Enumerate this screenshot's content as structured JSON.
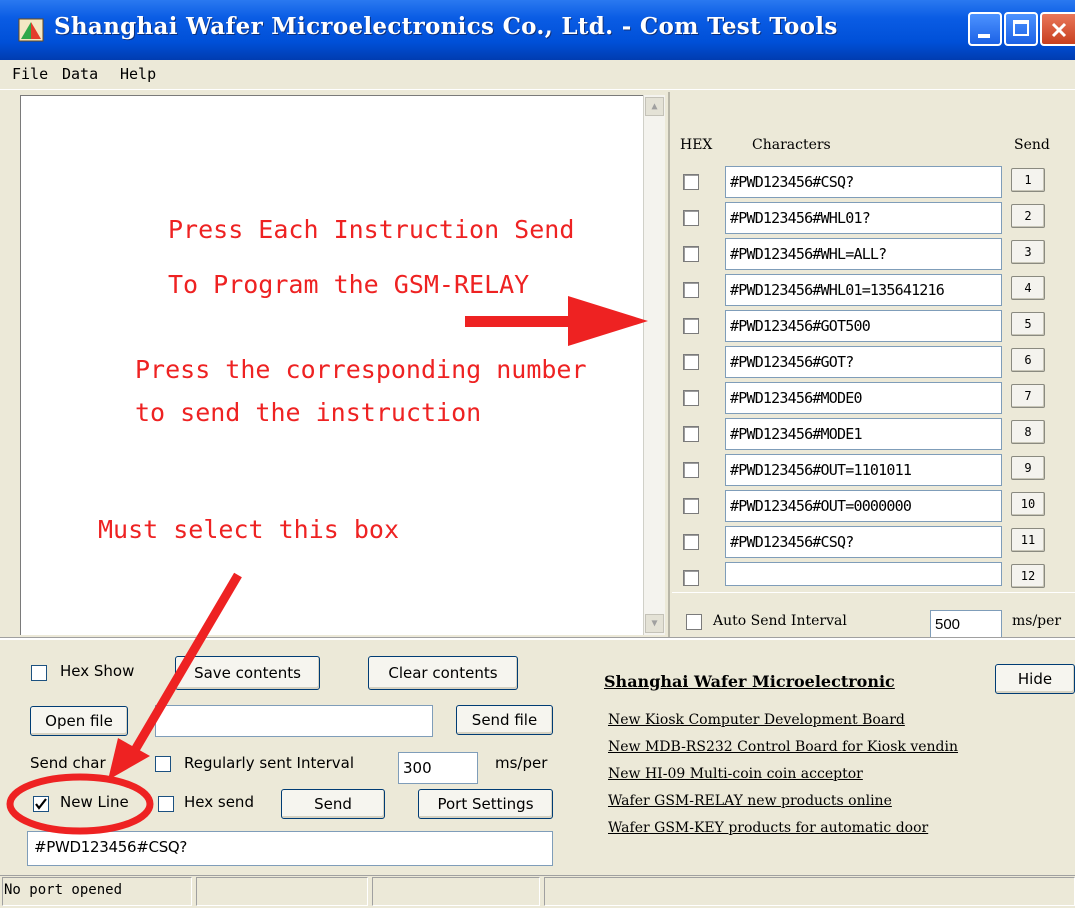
{
  "window": {
    "title": "Shanghai Wafer Microelectronics Co., Ltd. - Com Test Tools"
  },
  "menu": [
    "File",
    "Data",
    "Help"
  ],
  "command_panel": {
    "headers": {
      "hex": "HEX",
      "characters": "Characters",
      "send": "Send"
    },
    "rows": [
      {
        "value": "#PWD123456#CSQ?",
        "send": "1"
      },
      {
        "value": "#PWD123456#WHL01?",
        "send": "2"
      },
      {
        "value": "#PWD123456#WHL=ALL?",
        "send": "3"
      },
      {
        "value": "#PWD123456#WHL01=135641216",
        "send": "4"
      },
      {
        "value": "#PWD123456#GOT500",
        "send": "5"
      },
      {
        "value": "#PWD123456#GOT?",
        "send": "6"
      },
      {
        "value": "#PWD123456#MODE0",
        "send": "7"
      },
      {
        "value": "#PWD123456#MODE1",
        "send": "8"
      },
      {
        "value": "#PWD123456#OUT=1101011",
        "send": "9"
      },
      {
        "value": "#PWD123456#OUT=0000000",
        "send": "10"
      },
      {
        "value": "#PWD123456#CSQ?",
        "send": "11"
      },
      {
        "value": "",
        "send": "12"
      }
    ],
    "auto_send": {
      "label": "Auto Send Interval",
      "value": "500",
      "unit": "ms/per"
    }
  },
  "annotations": {
    "line1": "Press Each Instruction Send",
    "line2": "To Program the GSM-RELAY",
    "line3": "Press the corresponding number",
    "line4": "to send the instruction",
    "line5": "Must select this box",
    "color": "#ee2222"
  },
  "controls": {
    "hex_show": "Hex Show",
    "save_contents": "Save contents",
    "clear_contents": "Clear contents",
    "open_file": "Open file",
    "send_file": "Send file",
    "send_char": "Send char",
    "regularly_sent": "Regularly sent Interval",
    "interval_value": "300",
    "interval_unit": "ms/per",
    "new_line": "New Line",
    "hex_send": "Hex send",
    "send": "Send",
    "port_settings": "Port Settings",
    "input_value": "#PWD123456#CSQ?"
  },
  "news": {
    "title": "Shanghai Wafer Microelectronic",
    "hide": "Hide",
    "links": [
      "New Kiosk Computer Development Board",
      "New MDB-RS232 Control Board for Kiosk vendin",
      "New HI-09 Multi-coin coin acceptor",
      "Wafer GSM-RELAY new products online",
      "Wafer GSM-KEY products for automatic door"
    ]
  },
  "status": {
    "port": "No port opened"
  },
  "colors": {
    "titlebar": "#0a5ce4",
    "annotation": "#ee2222",
    "window_bg": "#ece9d8"
  }
}
